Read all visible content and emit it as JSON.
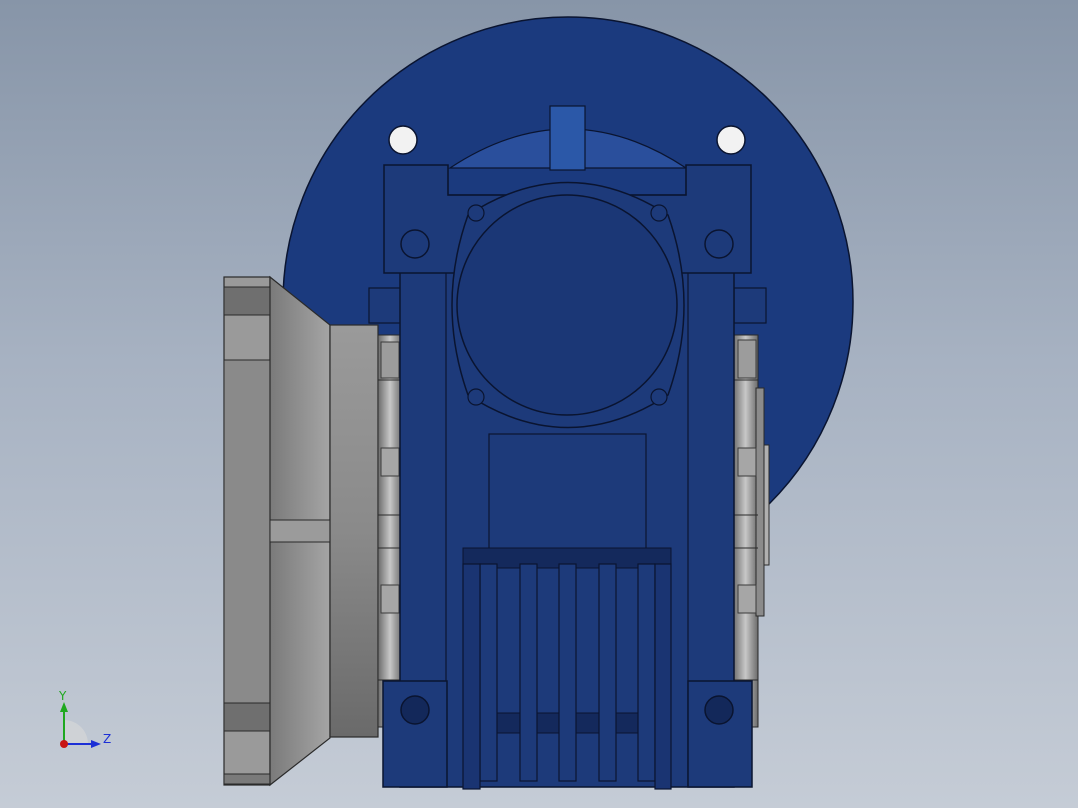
{
  "viewport": {
    "background_top": "#8795a8",
    "background_bottom": "#c5ccd6"
  },
  "model": {
    "housing_color": "#1d3a7a",
    "housing_dark": "#14295c",
    "flange_color": "#193a82",
    "outline_color": "#0a1430",
    "metal_light": "#b9b9b9",
    "metal_mid": "#8c8c8c",
    "metal_dark": "#5a5a5a"
  },
  "triad": {
    "y_label": "Y",
    "z_label": "Z",
    "y_color": "#1fa81f",
    "z_color": "#1c2fd6",
    "x_color": "#c81414"
  }
}
